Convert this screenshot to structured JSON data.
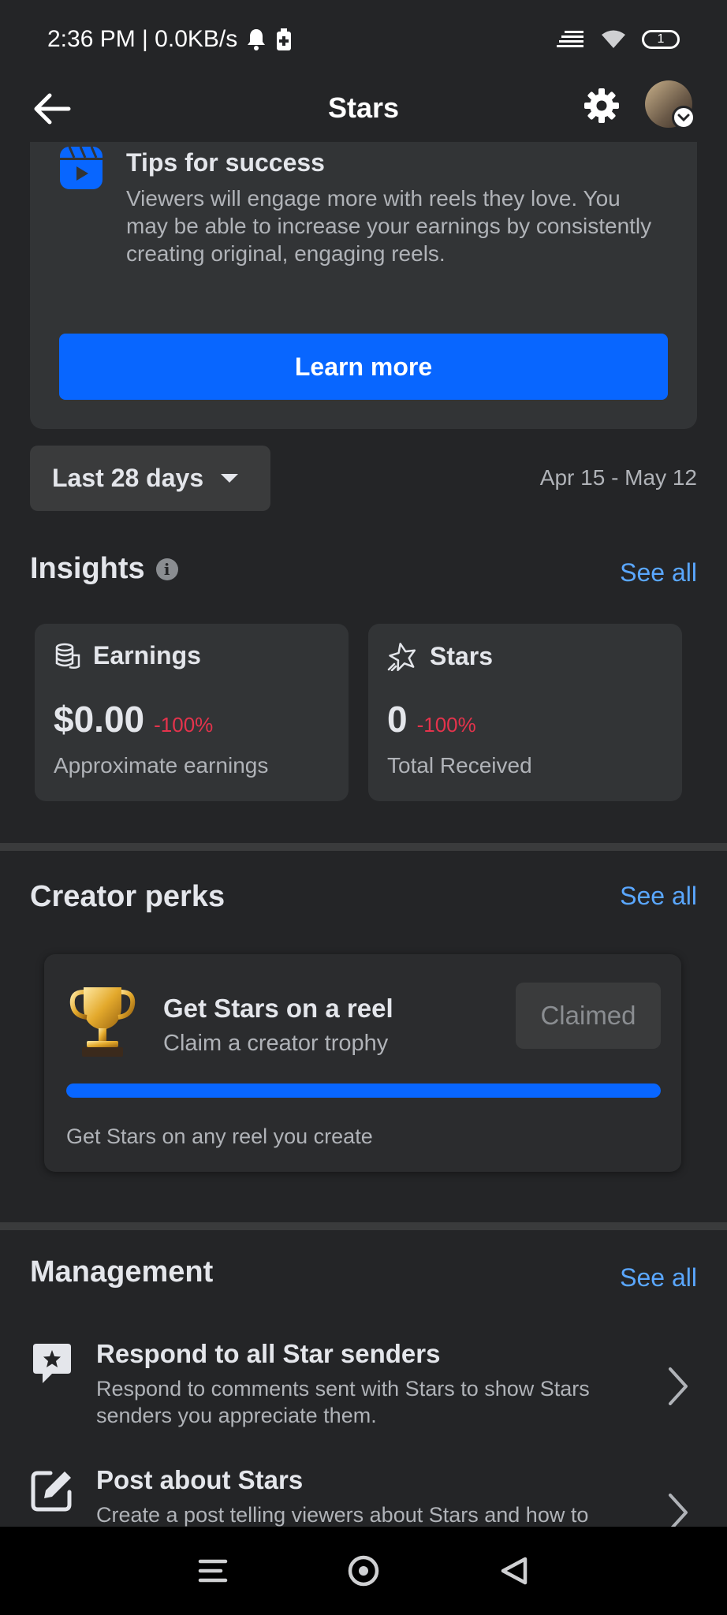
{
  "status_bar": {
    "time": "2:36 PM | 0.0KB/s",
    "battery": "1"
  },
  "header": {
    "title": "Stars"
  },
  "tips": {
    "title": "Tips for success",
    "body": "Viewers will engage more with reels they love. You may be able to increase your earnings by consistently creating original, engaging reels.",
    "button_label": "Learn more"
  },
  "date_range": {
    "selected": "Last 28 days",
    "dates": "Apr 15 - May 12"
  },
  "insights": {
    "title": "Insights",
    "see_all": "See all",
    "cards": [
      {
        "label": "Earnings",
        "value": "$0.00",
        "change": "-100%",
        "sublabel": "Approximate earnings"
      },
      {
        "label": "Stars",
        "value": "0",
        "change": "-100%",
        "sublabel": "Total Received"
      }
    ]
  },
  "creator_perks": {
    "title": "Creator perks",
    "see_all": "See all",
    "perk": {
      "title": "Get Stars on a reel",
      "subtitle": "Claim a creator trophy",
      "button_label": "Claimed",
      "progress": 1.0,
      "footer": "Get Stars on any reel you create"
    }
  },
  "management": {
    "title": "Management",
    "see_all": "See all",
    "items": [
      {
        "title": "Respond to all Star senders",
        "desc": "Respond to comments sent with Stars to show Stars senders you appreciate them."
      },
      {
        "title": "Post about Stars",
        "desc": "Create a post telling viewers about Stars and how to"
      }
    ]
  },
  "colors": {
    "background": "#242527",
    "card": "#323436",
    "accent_blue": "#0866ff",
    "link_blue": "#5aa7ff",
    "negative_red": "#e4334c"
  },
  "icons": [
    "bell-icon",
    "battery-saver-icon",
    "signal-icon",
    "wifi-icon",
    "battery-icon",
    "back-arrow-icon",
    "gear-icon",
    "reels-icon",
    "info-icon",
    "coins-icon",
    "star-icon",
    "trophy-icon",
    "star-comment-icon",
    "edit-icon",
    "chevron-right-icon",
    "menu-icon",
    "home-circle-icon",
    "back-triangle-icon"
  ]
}
